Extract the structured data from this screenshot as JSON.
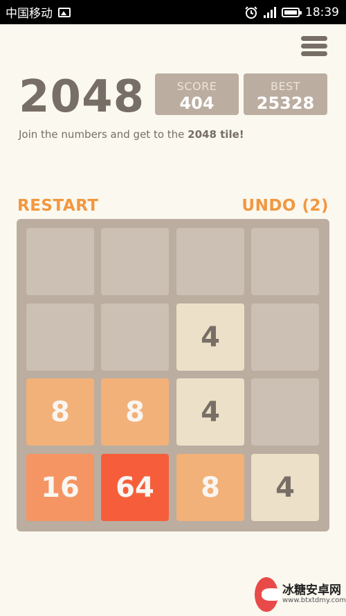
{
  "status_bar": {
    "carrier": "中国移动",
    "time": "18:39"
  },
  "game": {
    "title": "2048",
    "score_label": "SCORE",
    "score_value": "404",
    "best_label": "BEST",
    "best_value": "25328",
    "intro_prefix": "Join the numbers and get to the ",
    "intro_bold": "2048 tile!",
    "restart_label": "RESTART",
    "undo_label": "UNDO (2)",
    "board": [
      [
        "",
        "",
        "",
        ""
      ],
      [
        "",
        "",
        "4",
        ""
      ],
      [
        "8",
        "8",
        "4",
        ""
      ],
      [
        "16",
        "64",
        "8",
        "4"
      ]
    ]
  },
  "watermark": {
    "title": "冰糖安卓网",
    "url": "www.btxtdmy.com"
  },
  "colors": {
    "background": "#faf8ef",
    "board": "#bbada0",
    "accent_orange": "#f2973f",
    "tile_4": "#ede0c8",
    "tile_8": "#f2b179",
    "tile_16": "#f59563",
    "tile_64": "#f65e3b"
  }
}
